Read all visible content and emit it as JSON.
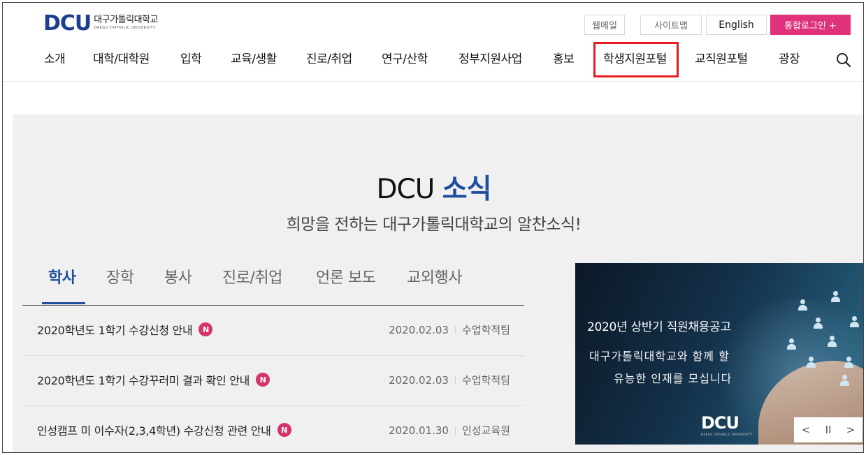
{
  "logo": {
    "mark": "DCU",
    "korean": "대구가톨릭대학교",
    "english": "DAEGU CATHOLIC UNIVERSITY"
  },
  "util": {
    "webmail": "웹메일",
    "sitemap": "사이트맵",
    "english": "English",
    "login": "통합로그인 +"
  },
  "nav": [
    "소개",
    "대학/대학원",
    "입학",
    "교육/생활",
    "진로/취업",
    "연구/산학",
    "정부지원사업",
    "홍보",
    "학생지원포털",
    "교직원포털",
    "광장"
  ],
  "highlight_color": "#e8191f",
  "news": {
    "title_prefix": "DCU",
    "title_accent": "소식",
    "subtitle": "희망을 전하는 대구가톨릭대학교의 알찬소식!",
    "tabs": [
      "학사",
      "장학",
      "봉사",
      "진로/취업",
      "언론 보도",
      "교외행사"
    ],
    "active_tab": "학사",
    "items": [
      {
        "title": "2020학년도 1학기 수강신청 안내",
        "badge": "N",
        "date": "2020.02.03",
        "dept": "수업학적팀"
      },
      {
        "title": "2020학년도 1학기 수강꾸러미 결과 확인 안내",
        "badge": "N",
        "date": "2020.02.03",
        "dept": "수업학적팀"
      },
      {
        "title": "인성캠프 미 이수자(2,3,4학년) 수강신청 관련 안내",
        "badge": "N",
        "date": "2020.01.30",
        "dept": "인성교육원"
      }
    ]
  },
  "banner": {
    "headline": "2020년 상반기 직원채용공고",
    "line1": "대구가톨릭대학교와 함께 할",
    "line2": "유능한 인재를 모십니다",
    "logo": "DCU",
    "logo_eng": "DAEGU CATHOLIC UNIVERSITY",
    "controls": {
      "prev": "<",
      "pause": "II",
      "next": ">"
    }
  },
  "colors": {
    "brand": "#1e3f91",
    "accent_blue": "#1d4f9e",
    "login_pink": "#e0327a",
    "badge": "#d5336c"
  }
}
